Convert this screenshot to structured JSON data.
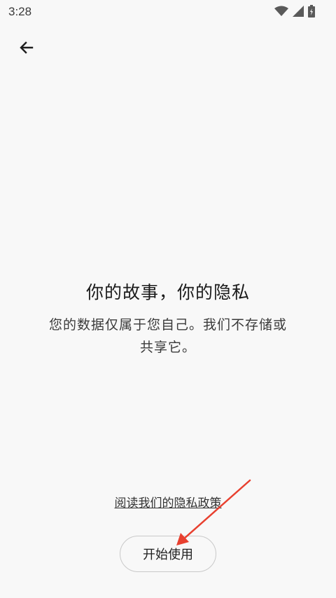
{
  "status_bar": {
    "time": "3:28",
    "icons": [
      "wifi-icon",
      "cellular-signal-icon",
      "battery-icon"
    ]
  },
  "nav": {
    "back_icon": "arrow-left-icon"
  },
  "main": {
    "title": "你的故事，你的隐私",
    "description": "您的数据仅属于您自己。我们不存储或共享它。"
  },
  "footer": {
    "privacy_link": "阅读我们的隐私政策",
    "start_button": "开始使用"
  },
  "annotation": {
    "arrow_color": "#e8402f"
  }
}
